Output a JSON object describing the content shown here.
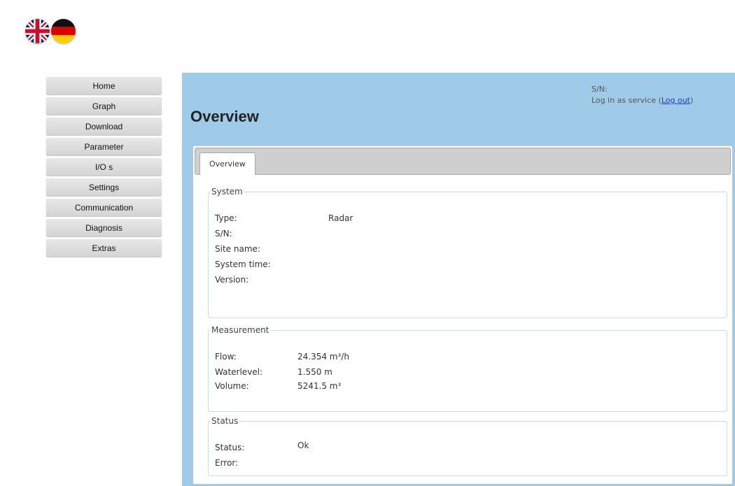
{
  "language_flags": [
    {
      "name": "english",
      "icon": "uk-flag-icon"
    },
    {
      "name": "german",
      "icon": "german-flag-icon"
    }
  ],
  "nav": {
    "items": [
      {
        "label": "Home"
      },
      {
        "label": "Graph"
      },
      {
        "label": "Download"
      },
      {
        "label": "Parameter"
      },
      {
        "label": "I/O s"
      },
      {
        "label": "Settings"
      },
      {
        "label": "Communication"
      },
      {
        "label": "Diagnosis"
      },
      {
        "label": "Extras"
      }
    ]
  },
  "header": {
    "sn_label": "S/N:",
    "login_text": "Log in as service (",
    "logout_label": "Log out",
    "login_close": ")",
    "page_title": "Overview"
  },
  "tabs": [
    {
      "label": "Overview"
    }
  ],
  "system": {
    "legend": "System",
    "rows": [
      {
        "label": "Type:",
        "value": "Radar"
      },
      {
        "label": "S/N:",
        "value": ""
      },
      {
        "label": "Site name:",
        "value": ""
      },
      {
        "label": "System time:",
        "value": ""
      },
      {
        "label": "Version:",
        "value": ""
      }
    ]
  },
  "measurement": {
    "legend": "Measurement",
    "rows": [
      {
        "label": "Flow:",
        "value": "24.354 m³/h"
      },
      {
        "label": "Waterlevel:",
        "value": "1.550 m"
      },
      {
        "label": "Volume:",
        "value": "5241.5 m³"
      }
    ]
  },
  "status": {
    "legend": "Status",
    "rows": [
      {
        "label": "Status:",
        "value": "Ok"
      },
      {
        "label": "Error:",
        "value": ""
      }
    ]
  },
  "colors": {
    "main_panel": "#9fcbe8",
    "nav_button": "#dcdcdc",
    "link": "#1a3cc8"
  }
}
